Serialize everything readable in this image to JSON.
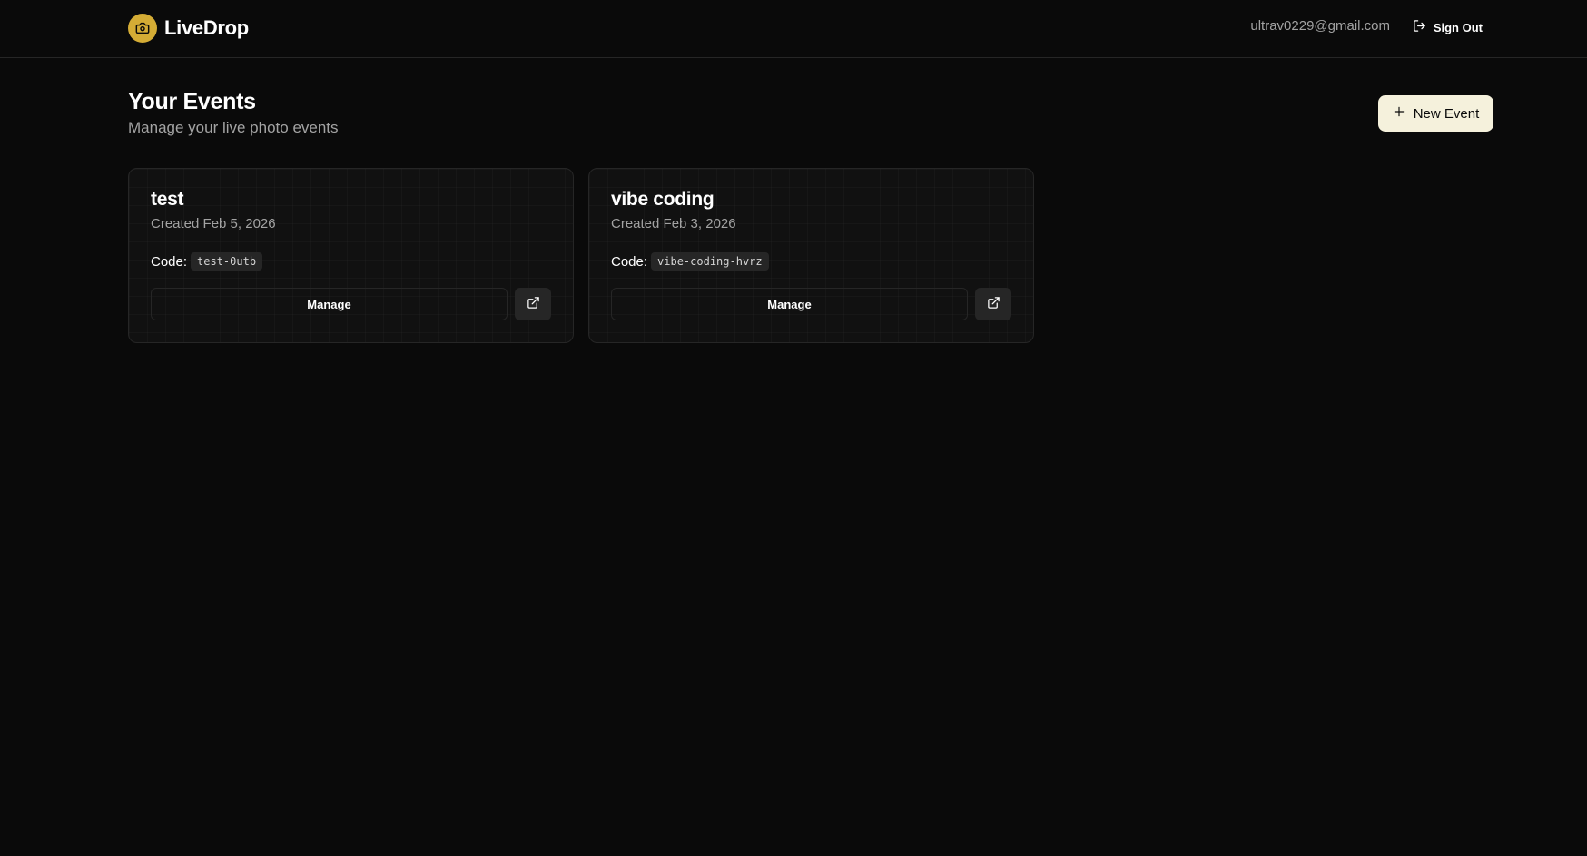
{
  "header": {
    "brand_name": "LiveDrop",
    "logo_icon": "camera-icon",
    "user_email": "ultrav0229@gmail.com",
    "signout_label": "Sign Out",
    "signout_icon": "log-out-icon"
  },
  "main": {
    "title": "Your Events",
    "subtitle": "Manage your live photo events",
    "new_event_label": "New Event",
    "new_event_icon": "plus-icon"
  },
  "events": [
    {
      "name": "test",
      "created": "Created Feb 5, 2026",
      "code_label": "Code:",
      "code": "test-0utb",
      "manage_label": "Manage",
      "open_icon": "external-link-icon"
    },
    {
      "name": "vibe coding",
      "created": "Created Feb 3, 2026",
      "code_label": "Code:",
      "code": "vibe-coding-hvrz",
      "manage_label": "Manage",
      "open_icon": "external-link-icon"
    }
  ],
  "colors": {
    "background": "#0a0a0a",
    "brand_accent": "#d4ac35",
    "primary_button": "#f5f1dc",
    "card_border": "#262626",
    "muted_text": "#a3a3a3"
  }
}
